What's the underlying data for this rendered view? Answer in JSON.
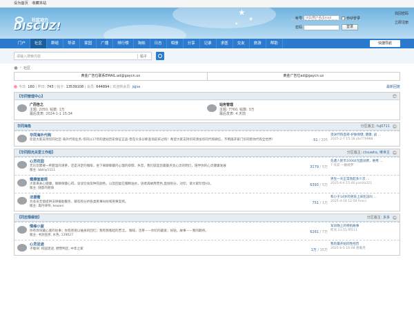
{
  "topbar": {
    "home": "设为首页",
    "favorite": "收藏本站"
  },
  "logo": {
    "text": "DISCUZ!",
    "sub": "社区动力"
  },
  "login": {
    "account_label": "帐号",
    "account_placeholder": "UID/用户名/Email",
    "autologin": "自动登录",
    "forgot": "找回密码",
    "password_label": "密码",
    "login_btn": "登录",
    "register": "立即注册"
  },
  "nav": {
    "items": [
      "门户",
      "社区",
      "群组",
      "导读",
      "家园",
      "广播",
      "排行榜",
      "淘帖",
      "日志",
      "相册",
      "分享",
      "记录",
      "求医",
      "交友",
      "旅游",
      "帮助"
    ],
    "active_index": 1,
    "quick": "快捷导航"
  },
  "search": {
    "placeholder": "请输入搜索内容",
    "type": "帖子"
  },
  "crumb": {
    "current": "社区"
  },
  "ads": [
    "黄金广告位联系EMAIL:ad@gaycn.us",
    "黄金广告位ad@gaycn.us"
  ],
  "stats": {
    "today_label": "今日:",
    "today": "160",
    "yesterday_label": "昨日:",
    "yesterday": "743",
    "posts_label": "帖子:",
    "posts": "13539108",
    "members_label": "会员:",
    "members": "644894",
    "welcome_label": "欢迎新会员:",
    "newest": "jqjsa",
    "latest": "最新回复"
  },
  "categories": [
    {
      "title": "【华同管理中心】",
      "layout": "grid",
      "boards": [
        {
          "name": "广而告之",
          "stats": "主题: 2050, 帖数: 1万",
          "last": "最后发表: 2024-1-1 15:34"
        },
        {
          "name": "站务管理",
          "stats": "主题: 7760, 帖数: 3万",
          "last": "最后发表: 4 天前"
        }
      ]
    },
    {
      "title": "华同海角",
      "moderator_label": "分区版主:",
      "moderator": "fuj0711",
      "boards": [
        {
          "name": "华同海外代购",
          "desc": "欢迎大家支持华同社区-海外代购业务-华同以17年的建站历史保证正品-曾在众多诊断查询前买过购！希望大家支持华同添加华同代购微信，不用再开家门华同帮你代购全世界！",
          "mods": "",
          "count1": "51",
          "count2": "205",
          "last_title": "澳洲代购直邮-护肤保健, 健康, 战 ...",
          "last_meta": "2025-2-7 15:18 jdx779988"
        }
      ]
    },
    {
      "title": "【华同阳光关爱工作组】",
      "moderator_label": "分区版主:",
      "moderator": "ctouwhs, 维世主",
      "boards": [
        {
          "name": "心灵花园",
          "desc": "无论您需要一杯甜温的清茶，还是决定的咖啡，坐下来聊聊最内心理的抑郁、失恋，我们就是您最最点亮心灵的明灯，陪伴你的心灵健康发展",
          "mods": "版主: bbtny1111",
          "count1": "3179",
          "count2": "5万",
          "last_title": "先遣人民币10000元面试费，要用 ...",
          "last_meta": "7 天前 一触碰梦"
        },
        {
          "name": "健康面面观",
          "desc": "大家来关心健康，聊聊保健心得，谈谈饮食及种花颜色，以及回复应服精油水，语者再故用营色,直接别分，对印，请大家珍惜HD。",
          "mods": "版主: 随意的朋骑",
          "count1": "6393",
          "count2": "5万",
          "last_title": "男生一天正常勃起多少次 ...",
          "last_meta": "2025-6-6 15:40 panda321"
        },
        {
          "name": "法援著",
          "desc": "为会员无偿提供法律援助服务，解答和分析各类民事纠纷和刑事案例。",
          "mods": "版主: 再丹律师, kewani",
          "count1": "751",
          "count2": "1万",
          "last_title": "和小于14岁的男孩上床犯法吗 ...",
          "last_meta": "2025-4-18 12:59 fnecc"
        }
      ]
    },
    {
      "title": "【同志情缘馆】",
      "moderator_label": "分区版主:",
      "moderator": "多多",
      "boards": [
        {
          "name": "情缘小屋",
          "desc": "你有你深藏心底的往事；你有爸爸以抽身的回忆；我有我看起的苦涩。 咖啡，活茶——你们的最爱；好贴，故事——我的期待。",
          "mods": "版主: 书剑狂侠, 水色, 139027",
          "count1": "6261",
          "count2": "7万",
          "last_title": "军训晚上的特别故事",
          "last_meta": "昨天 23:55 fff111"
        },
        {
          "name": "心灵足迹",
          "desc": "子版块: 校园足迹, 野营鸭区, 中年之家",
          "mods": "",
          "count1": "1万",
          "count2": "15万",
          "last_title": "我的最开始同性经历",
          "last_meta": "2025-6-5 16:08 想着月"
        }
      ]
    }
  ]
}
